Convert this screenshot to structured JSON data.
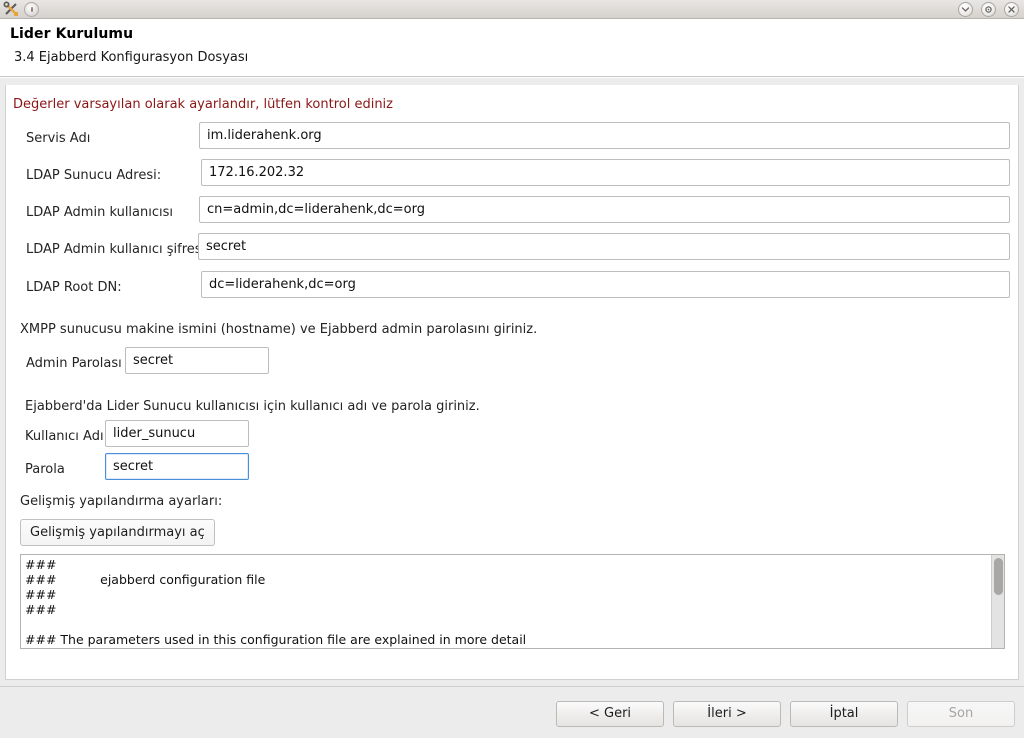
{
  "window": {
    "icons": {
      "app": "tools-icon",
      "round": "record-button-icon",
      "minimize": "chevron-down-icon",
      "maximize": "gear-icon",
      "close": "close-icon"
    }
  },
  "header": {
    "title": "Lider Kurulumu",
    "subtitle": "3.4 Ejabberd Konfigurasyon Dosyası"
  },
  "content": {
    "warning": "Değerler varsayılan olarak ayarlandır, lütfen kontrol ediniz",
    "fields": [
      {
        "label": "Servis Adı",
        "value": "im.liderahenk.org"
      },
      {
        "label": "LDAP Sunucu Adresi:",
        "value": "172.16.202.32"
      },
      {
        "label": "LDAP Admin kullanıcısı",
        "value": "cn=admin,dc=liderahenk,dc=org"
      },
      {
        "label": "LDAP Admin kullanıcı şifresi",
        "value": "secret"
      },
      {
        "label": "LDAP Root DN:",
        "value": "dc=liderahenk,dc=org"
      }
    ],
    "xmpp_note": "XMPP sunucusu makine ismini (hostname) ve Ejabberd admin parolasını giriniz.",
    "admin_password": {
      "label": "Admin Parolası",
      "value": "secret"
    },
    "lider_note": "Ejabberd'da Lider Sunucu kullanıcısı için kullanıcı adı ve parola giriniz.",
    "username": {
      "label": "Kullanıcı Adı",
      "value": "lider_sunucu"
    },
    "password": {
      "label": "Parola",
      "value": "secret"
    },
    "advanced_label": "Gelişmiş yapılandırma ayarları:",
    "advanced_button": "Gelişmiş yapılandırmayı aç",
    "config_text": "###\n###           ejabberd configuration file\n###\n###\n\n### The parameters used in this configuration file are explained in more detail"
  },
  "footer": {
    "buttons": [
      {
        "label": "< Geri",
        "disabled": false
      },
      {
        "label": "İleri >",
        "disabled": false
      },
      {
        "label": "İptal",
        "disabled": false
      },
      {
        "label": "Son",
        "disabled": true
      }
    ]
  },
  "colors": {
    "warning": "#8c1616",
    "focus_border": "#4a90d9",
    "panel_bg": "#ffffff",
    "chrome_bg": "#ececec"
  }
}
